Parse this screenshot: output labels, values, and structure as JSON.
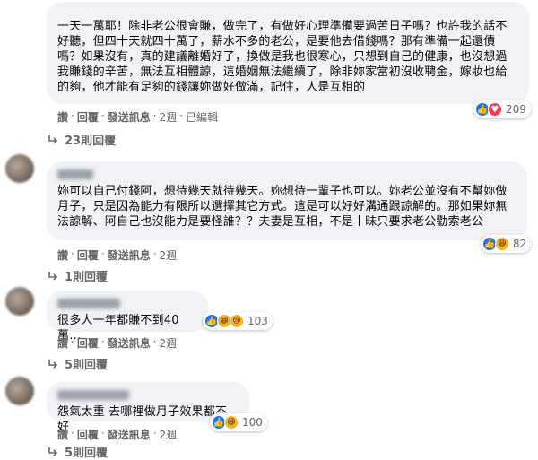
{
  "comments": [
    {
      "text": "一天一萬耶！除非老公很會賺，做完了，有做好心理準備要過苦日子嗎？也許我的話不好聽，但四十天就四十萬了，薪水不多的老公，是要他去借錢嗎？那有準備一起還債嗎？如果沒有，真的建議離婚好了，換做是我也很寒心，只想到自己的健康，也沒想過我賺錢的辛苦，無法互相體諒，這婚姻無法繼續了，除非妳家當初沒收聘金，嫁妝也給的夠，他才能有足夠的錢讓妳做好做滿，記住，人是互相的",
      "reaction_icons": [
        "like-icon",
        "love-icon"
      ],
      "reaction_count": "209",
      "actions": {
        "like": "讚",
        "reply": "回覆",
        "message": "發送訊息",
        "time": "2週",
        "edited": "已編輯"
      },
      "replies": "23則回覆"
    },
    {
      "text": "妳可以自己付錢阿，想待幾天就待幾天。妳想待一輩子也可以。妳老公並沒有不幫妳做月子，只是因為能力有限所以選擇其它方式。這是可以好好溝通跟諒解的。那如果妳無法諒解、阿自己也沒能力是要怪誰？？夫妻是互相，不是丨昧只要求老公勸索老公",
      "reaction_icons": [
        "like-icon",
        "haha-icon"
      ],
      "reaction_count": "82",
      "actions": {
        "like": "讚",
        "reply": "回覆",
        "message": "發送訊息",
        "time": "2週"
      },
      "replies": "1則回覆"
    },
    {
      "text": "很多人一年都賺不到40萬…",
      "reaction_icons": [
        "like-icon",
        "haha-icon",
        "sad-icon"
      ],
      "reaction_count": "103",
      "actions": {
        "like": "讚",
        "reply": "回覆",
        "message": "發送訊息",
        "time": "2週"
      },
      "replies": "5則回覆"
    },
    {
      "text": "怨氣太重 去哪裡做月子效果都不好",
      "reaction_icons": [
        "like-icon",
        "haha-icon"
      ],
      "reaction_count": "100",
      "actions": {
        "like": "讚",
        "reply": "回覆",
        "message": "發送訊息",
        "time": "2週"
      },
      "replies": "5則回覆"
    }
  ]
}
